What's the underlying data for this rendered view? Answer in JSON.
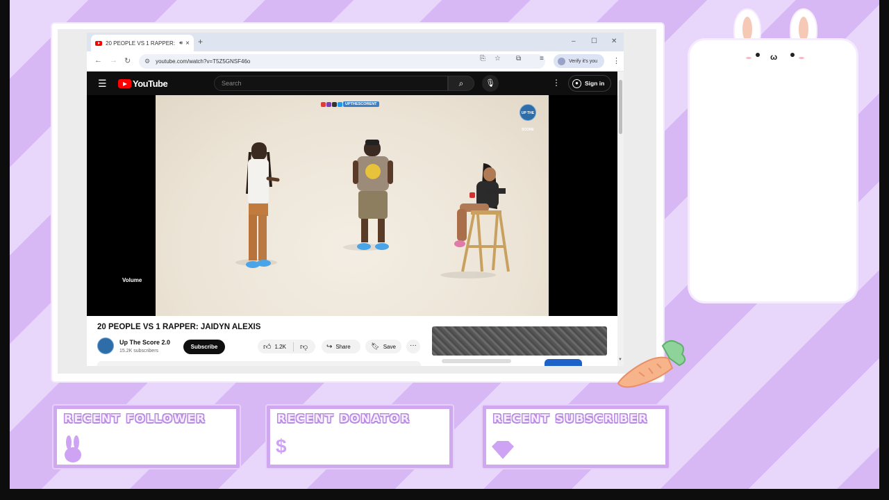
{
  "browser": {
    "tab_title": "20 PEOPLE VS 1 RAPPER: JA",
    "tab_audio_icon": "speaker-icon",
    "new_tab": "+",
    "url": "youtube.com/watch?v=T5Z5GNSF46o",
    "verify_label": "Verify it's you",
    "window_controls": [
      "–",
      "☐",
      "✕"
    ]
  },
  "youtube": {
    "logo_text": "YouTube",
    "search_placeholder": "Search",
    "sign_in": "Sign in",
    "player": {
      "volume_label": "Volume",
      "overlay_handle": "UPTHESCORENT",
      "badge_text": "UP THE SCORE"
    },
    "video": {
      "title": "20 PEOPLE VS 1 RAPPER: JAIDYN ALEXIS",
      "channel_name": "Up The Score 2.0",
      "subscribers": "15.2K subscribers",
      "subscribe_label": "Subscribe",
      "likes": "1.2K",
      "share_label": "Share",
      "save_label": "Save",
      "more_label": "···"
    }
  },
  "overlay": {
    "recent_follower": "RECENT FOLLOWER",
    "recent_donator": "RECENT DONATOR",
    "recent_subscriber": "RECENT SUBSCRIBER",
    "donator_symbol": "$"
  },
  "colors": {
    "stripe_light": "#e9d6fb",
    "stripe_dark": "#d8b8f4",
    "box_border": "#cfa8f0",
    "yt_red": "#ff0000"
  }
}
